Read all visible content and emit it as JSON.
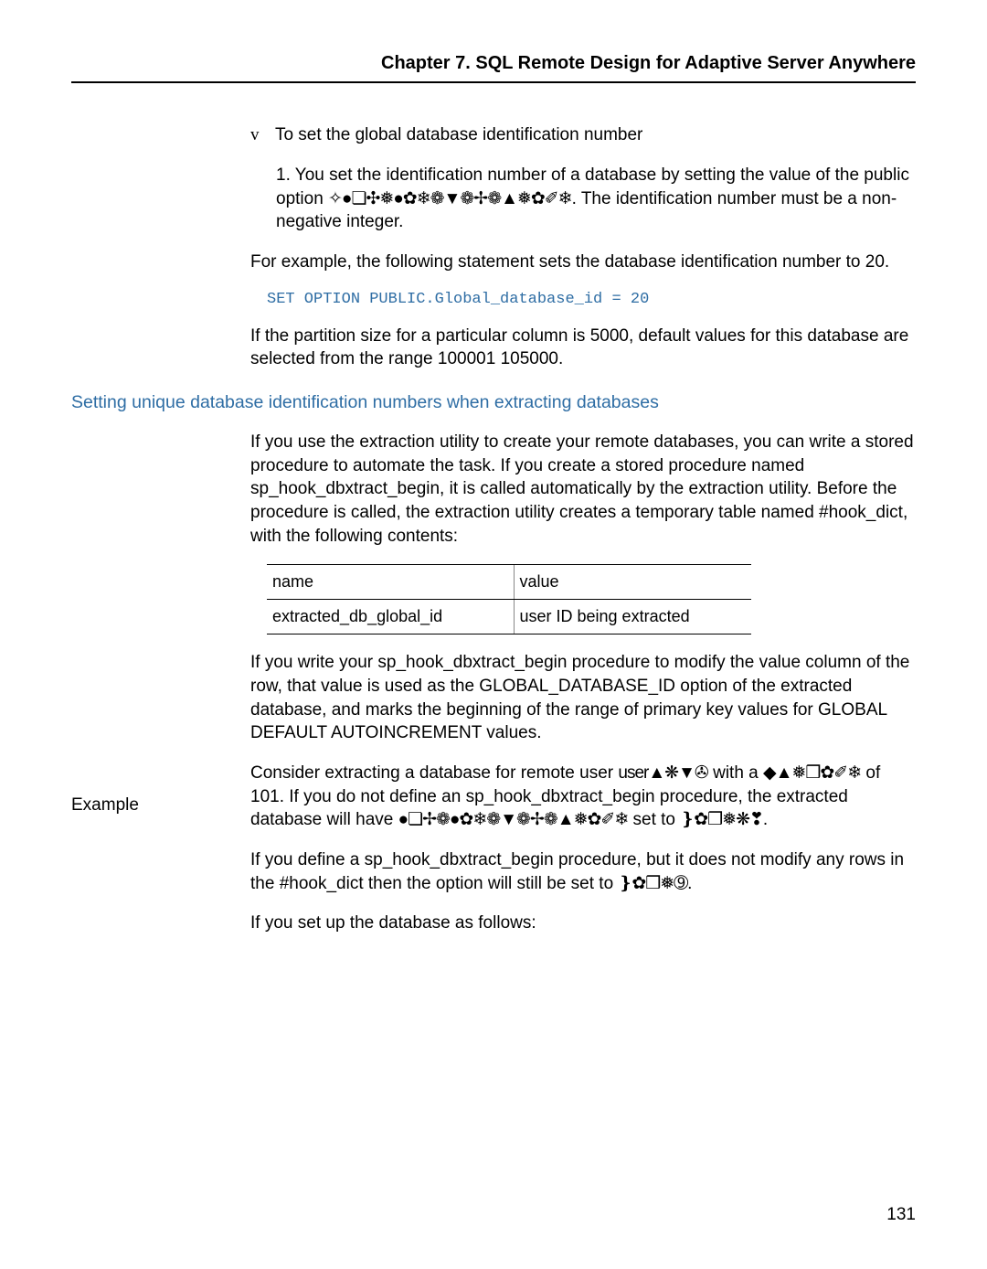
{
  "chapter_header": "Chapter 7.  SQL Remote Design for Adaptive Server Anywhere",
  "proc": {
    "marker": "v",
    "title": "To set the global database identiﬁcation number",
    "step1_num": "1.",
    "step1_a": "You set the identiﬁcation number of a database by setting the value of the public option ",
    "step1_garble": "✧●❏✣❅●✿❄❁▼❁✢❁▲❅✿✐❄",
    "step1_b": ". The identiﬁcation number must be a non-negative integer."
  },
  "example_intro": "For example, the following statement sets the database identiﬁcation number to 20.",
  "code_line": "SET OPTION PUBLIC.Global_database_id = 20",
  "partition_para": "If the partition size for a particular column is 5000, default values for this database are selected from the range 100001 105000.",
  "section_title": "Setting unique database identiﬁcation numbers when extracting databases",
  "extract_para": "If you use the extraction utility to create your remote databases, you can write a stored procedure to automate the task. If you create a stored procedure named sp_hook_dbxtract_begin, it is called automatically by the extraction utility. Before the procedure is called, the extraction utility creates a temporary table named #hook_dict, with the following contents:",
  "table": {
    "h1": "name",
    "h2": "value",
    "r1c1": "extracted_db_global_id",
    "r1c2": "user ID being extracted"
  },
  "write_para": "If you write your sp_hook_dbxtract_begin procedure to modify the value column of the row, that value is used as the GLOBAL_DATABASE_ID option of the extracted database, and marks the beginning of the range of primary key values for GLOBAL DEFAULT AUTOINCREMENT values.",
  "example_label": "Example",
  "ex_p1_a": "Consider extracting a database for remote user ",
  "ex_p1_g1": "user▲❋▼✇",
  "ex_p1_b": " with a ",
  "ex_p1_g2": "◆▲❅❒✿✐❄",
  "ex_p1_c": " of 101. If you do not deﬁne an sp_hook_dbxtract_begin procedure, the extracted database will have ",
  "ex_p1_g3": "●❏✢❁●✿❄❁▼❁✢❁▲❅✿✐❄",
  "ex_p1_d": " set to ",
  "ex_p1_g4": "❵✿❒❅❋❣",
  "ex_p1_e": ".",
  "ex_p2_a": "If you deﬁne a sp_hook_dbxtract_begin procedure, but it does not modify any rows in the #hook_dict then the option will still be set to ",
  "ex_p2_g": "❵✿❒❅➈",
  "ex_p2_b": ".",
  "ex_p3": "If you set up the database as follows:",
  "page_number": "131"
}
